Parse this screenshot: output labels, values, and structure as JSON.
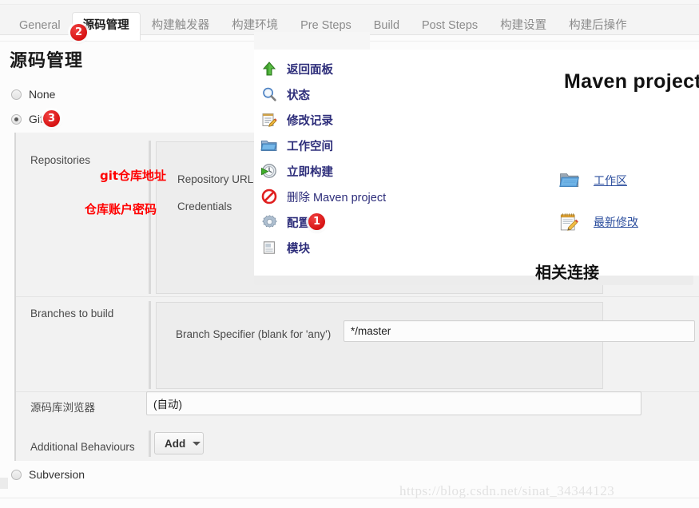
{
  "tabs": [
    {
      "label": "General",
      "active": false
    },
    {
      "label": "源码管理",
      "active": true
    },
    {
      "label": "构建触发器",
      "active": false
    },
    {
      "label": "构建环境",
      "active": false
    },
    {
      "label": "Pre Steps",
      "active": false
    },
    {
      "label": "Build",
      "active": false
    },
    {
      "label": "Post Steps",
      "active": false
    },
    {
      "label": "构建设置",
      "active": false
    },
    {
      "label": "构建后操作",
      "active": false
    }
  ],
  "page": {
    "title": "源码管理"
  },
  "scm": {
    "none_label": "None",
    "git_label": "Git",
    "subversion_label": "Subversion"
  },
  "git": {
    "repositories_label": "Repositories",
    "repository_url_label": "Repository URL",
    "credentials_label": "Credentials",
    "branches_label": "Branches to build",
    "branch_specifier_label": "Branch Specifier (blank for 'any')",
    "branch_specifier_value": "*/master",
    "browser_label": "源码库浏览器",
    "browser_value": "(自动)",
    "additional_behaviours_label": "Additional Behaviours",
    "add_button_label": "Add"
  },
  "annotations": {
    "repo_url_note": "git仓库地址",
    "credentials_note": "仓库账户密码",
    "badge_config": "1",
    "badge_scm_tab": "2",
    "badge_git_radio": "3"
  },
  "menu": {
    "items": [
      {
        "label": "返回面板",
        "icon": "up-arrow-icon",
        "cn": true
      },
      {
        "label": "状态",
        "icon": "magnifier-icon",
        "cn": true
      },
      {
        "label": "修改记录",
        "icon": "notepad-pencil-icon",
        "cn": true
      },
      {
        "label": "工作空间",
        "icon": "folder-icon",
        "cn": true
      },
      {
        "label": "立即构建",
        "icon": "build-now-icon",
        "cn": true
      },
      {
        "label": "删除 Maven project",
        "icon": "delete-forbidden-icon",
        "cn": false
      },
      {
        "label": "配置",
        "icon": "gear-icon",
        "cn": true
      },
      {
        "label": "模块",
        "icon": "module-icon",
        "cn": true
      }
    ]
  },
  "project": {
    "title": "Maven project",
    "workspace_link": "工作区",
    "latest_changes_link": "最新修改",
    "related_links_title": "相关连接"
  },
  "watermark": {
    "text": "https://blog.csdn.net/sinat_34344123"
  },
  "colors": {
    "badge_red": "#cc0000",
    "annotation_red": "#ff0000",
    "link_blue": "#2d4f9e",
    "menu_text": "#2d2d7a"
  }
}
